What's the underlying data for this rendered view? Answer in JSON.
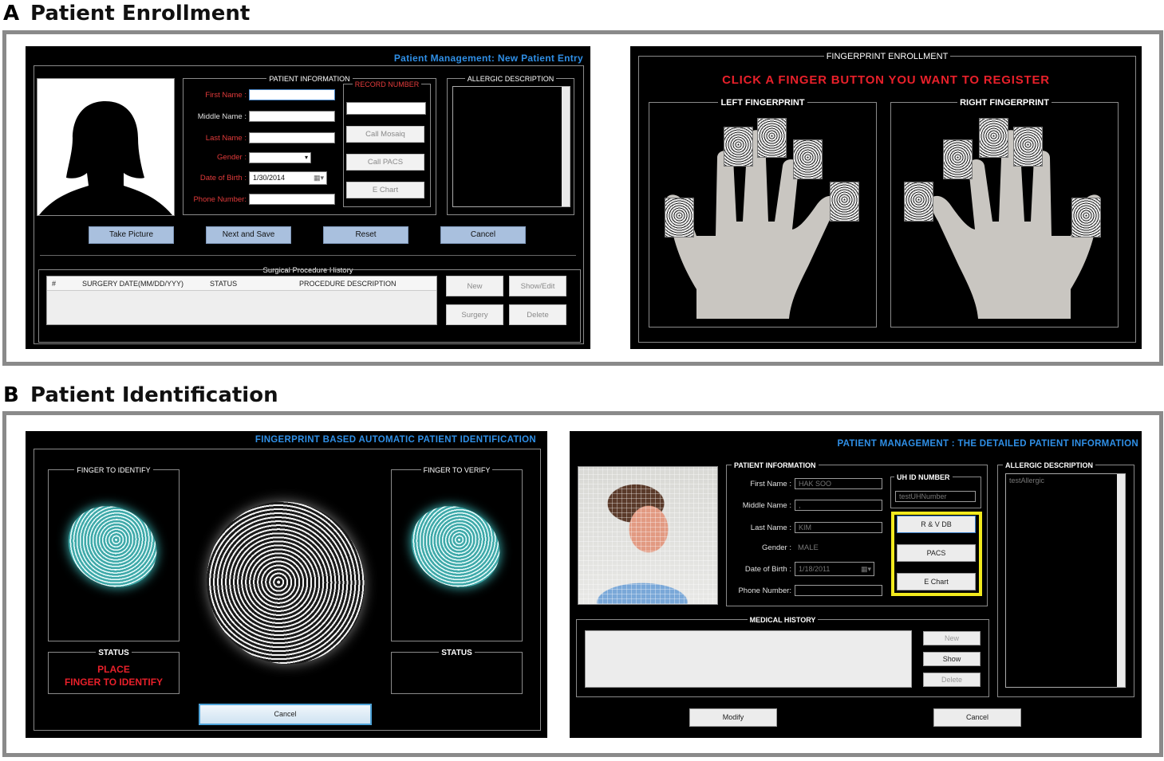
{
  "section_a": {
    "letter": "A",
    "title": "Patient Enrollment"
  },
  "section_b": {
    "letter": "B",
    "title": "Patient Identification"
  },
  "enroll": {
    "title": "Patient Management: New Patient Entry",
    "patient_info_title": "PATIENT INFORMATION",
    "labels": {
      "first_name": "First Name :",
      "middle_name": "Middle Name :",
      "last_name": "Last Name :",
      "gender": "Gender :",
      "dob": "Date of Birth :",
      "phone": "Phone Number:"
    },
    "dob_value": "1/30/2014",
    "record_number_title": "RECORD NUMBER",
    "buttons": {
      "call_mosaiq": "Call Mosaiq",
      "call_pacs": "Call PACS",
      "e_chart": "E Chart"
    },
    "allergic_title": "ALLERGIC DESCRIPTION",
    "actions": {
      "take_picture": "Take Picture",
      "next_save": "Next and Save",
      "reset": "Reset",
      "cancel": "Cancel"
    },
    "surgical_title": "Surgical Procedure History",
    "table_headers": {
      "num": "#",
      "date": "SURGERY DATE(MM/DD/YYY)",
      "status": "STATUS",
      "desc": "PROCEDURE DESCRIPTION"
    },
    "table_buttons": {
      "new": "New",
      "show_edit": "Show/Edit",
      "surgery": "Surgery",
      "delete": "Delete"
    }
  },
  "fingerprint": {
    "title": "FINGERPRINT ENROLLMENT",
    "instruction": "CLICK A FINGER BUTTON YOU WANT TO REGISTER",
    "left": "LEFT FINGERPRINT",
    "right": "RIGHT FINGERPRINT"
  },
  "identify": {
    "title": "FINGERPRINT BASED AUTOMATIC PATIENT IDENTIFICATION",
    "finger_identify": "FINGER TO IDENTIFY",
    "finger_verify": "FINGER TO VERIFY",
    "status": "STATUS",
    "status_line1": "PLACE",
    "status_line2": "FINGER TO IDENTIFY",
    "cancel": "Cancel"
  },
  "detail": {
    "title": "PATIENT MANAGEMENT : THE DETAILED PATIENT INFORMATION",
    "patient_info_title": "PATIENT INFORMATION",
    "labels": {
      "first_name": "First Name :",
      "middle_name": "Middle Name :",
      "last_name": "Last Name :",
      "gender": "Gender :",
      "dob": "Date of Birth :",
      "phone": "Phone Number:"
    },
    "values": {
      "first_name": "HAK SOO",
      "middle_name": ",",
      "last_name": "KIM",
      "gender": "MALE",
      "dob": "1/18/2011"
    },
    "uh_title": "UH ID NUMBER",
    "uh_value": "testUHNumber",
    "buttons": {
      "rv_db": "R & V DB",
      "pacs": "PACS",
      "e_chart": "E Chart"
    },
    "allergic_title": "ALLERGIC DESCRIPTION",
    "allergic_value": "testAllergic",
    "medical_title": "MEDICAL HISTORY",
    "med_buttons": {
      "new": "New",
      "show": "Show",
      "delete": "Delete"
    },
    "modify": "Modify",
    "cancel": "Cancel"
  },
  "colors": {
    "title_blue": "#2f8fe6",
    "alert_red": "#e8202a",
    "highlight_yellow": "#f2ea1d",
    "button_blue": "#a9c0de",
    "hand_gray": "#c9c6c1"
  }
}
